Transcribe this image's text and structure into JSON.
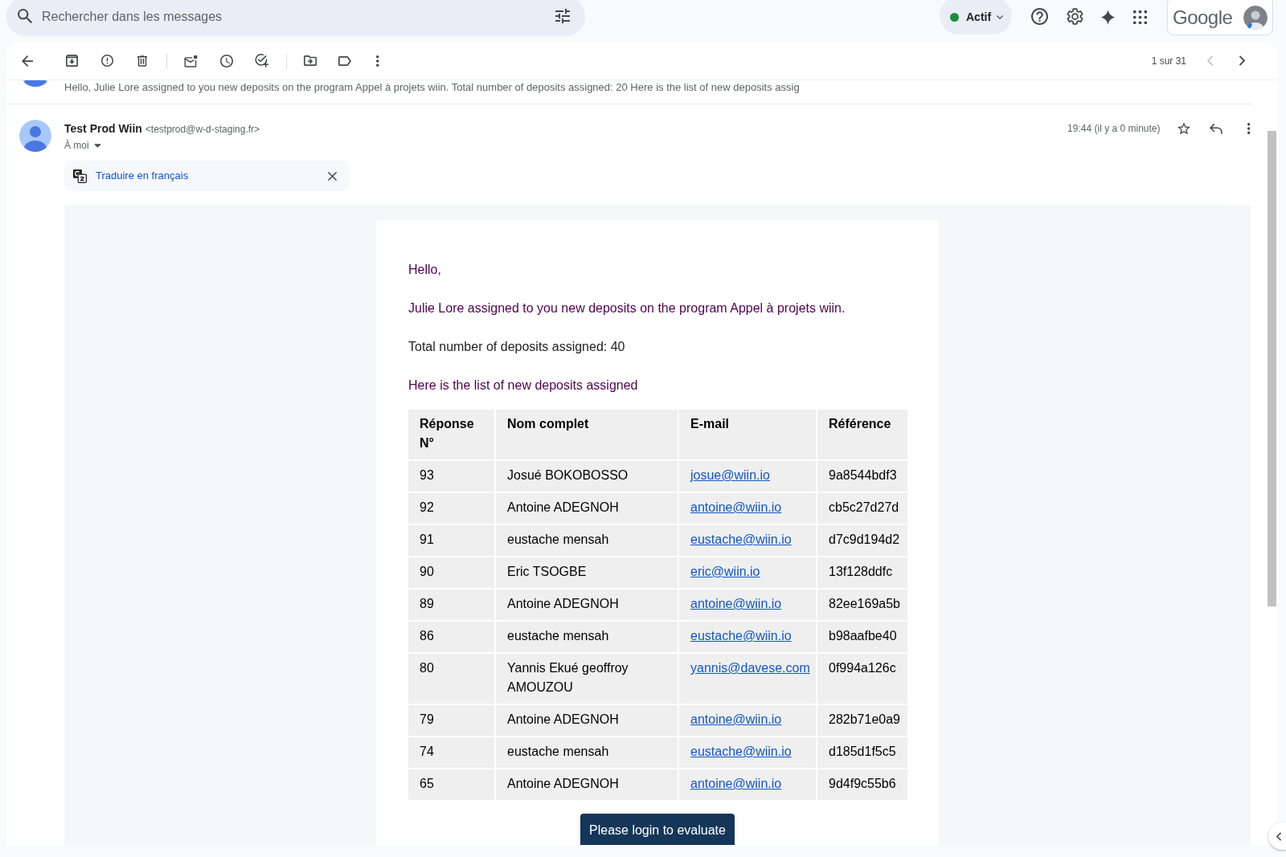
{
  "search": {
    "placeholder": "Rechercher dans les messages"
  },
  "status": {
    "label": "Actif"
  },
  "account": {
    "logo": "Google"
  },
  "toolbar": {
    "pager": "1 sur 31",
    "prev": {
      "disabled": true
    },
    "next": {
      "disabled": false
    }
  },
  "collapsed_message": {
    "snippet": "Hello, Julie Lore assigned to you new deposits on the program Appel à projets wiin. Total number of deposits assigned: 20 Here is the list of new deposits assig"
  },
  "message": {
    "sender_name": "Test Prod Wiin",
    "sender_email": "<testprod@w-d-staging.fr>",
    "recipient": "À moi",
    "time": "19:44 (il y a 0 minute)",
    "starred": false,
    "translate_banner": {
      "label": "Traduire en français"
    },
    "body": {
      "paragraphs": [
        {
          "text": "Hello,",
          "color": "#500050"
        },
        {
          "text": "Julie Lore assigned to you new deposits on the program Appel à projets wiin.",
          "color": "#500050"
        },
        {
          "text": "Total number of deposits assigned: 40",
          "color": "#222222"
        },
        {
          "text": "Here is the list of new deposits assigned",
          "color": "#500050"
        }
      ],
      "table": {
        "columns": [
          "Réponse N°",
          "Nom complet",
          "E-mail",
          "Référence"
        ],
        "rows": [
          {
            "number": "93",
            "name": "Josué BOKOBOSSO",
            "email": "josue@wiin.io",
            "reference": "9a8544bdf3"
          },
          {
            "number": "92",
            "name": "Antoine ADEGNOH",
            "email": "antoine@wiin.io",
            "reference": "cb5c27d27d"
          },
          {
            "number": "91",
            "name": "eustache mensah",
            "email": "eustache@wiin.io",
            "reference": "d7c9d194d2"
          },
          {
            "number": "90",
            "name": "Eric TSOGBE",
            "email": "eric@wiin.io",
            "reference": "13f128ddfc"
          },
          {
            "number": "89",
            "name": "Antoine ADEGNOH",
            "email": "antoine@wiin.io",
            "reference": "82ee169a5b"
          },
          {
            "number": "86",
            "name": "eustache mensah",
            "email": "eustache@wiin.io",
            "reference": "b98aafbe40"
          },
          {
            "number": "80",
            "name": "Yannis Ekué geoffroy AMOUZOU",
            "email": "yannis@davese.com",
            "reference": "0f994a126c"
          },
          {
            "number": "79",
            "name": "Antoine ADEGNOH",
            "email": "antoine@wiin.io",
            "reference": "282b71e0a9"
          },
          {
            "number": "74",
            "name": "eustache mensah",
            "email": "eustache@wiin.io",
            "reference": "d185d1f5c5"
          },
          {
            "number": "65",
            "name": "Antoine ADEGNOH",
            "email": "antoine@wiin.io",
            "reference": "9d4f9c55b6"
          }
        ]
      },
      "button": {
        "label": "Please login to evaluate"
      }
    }
  }
}
